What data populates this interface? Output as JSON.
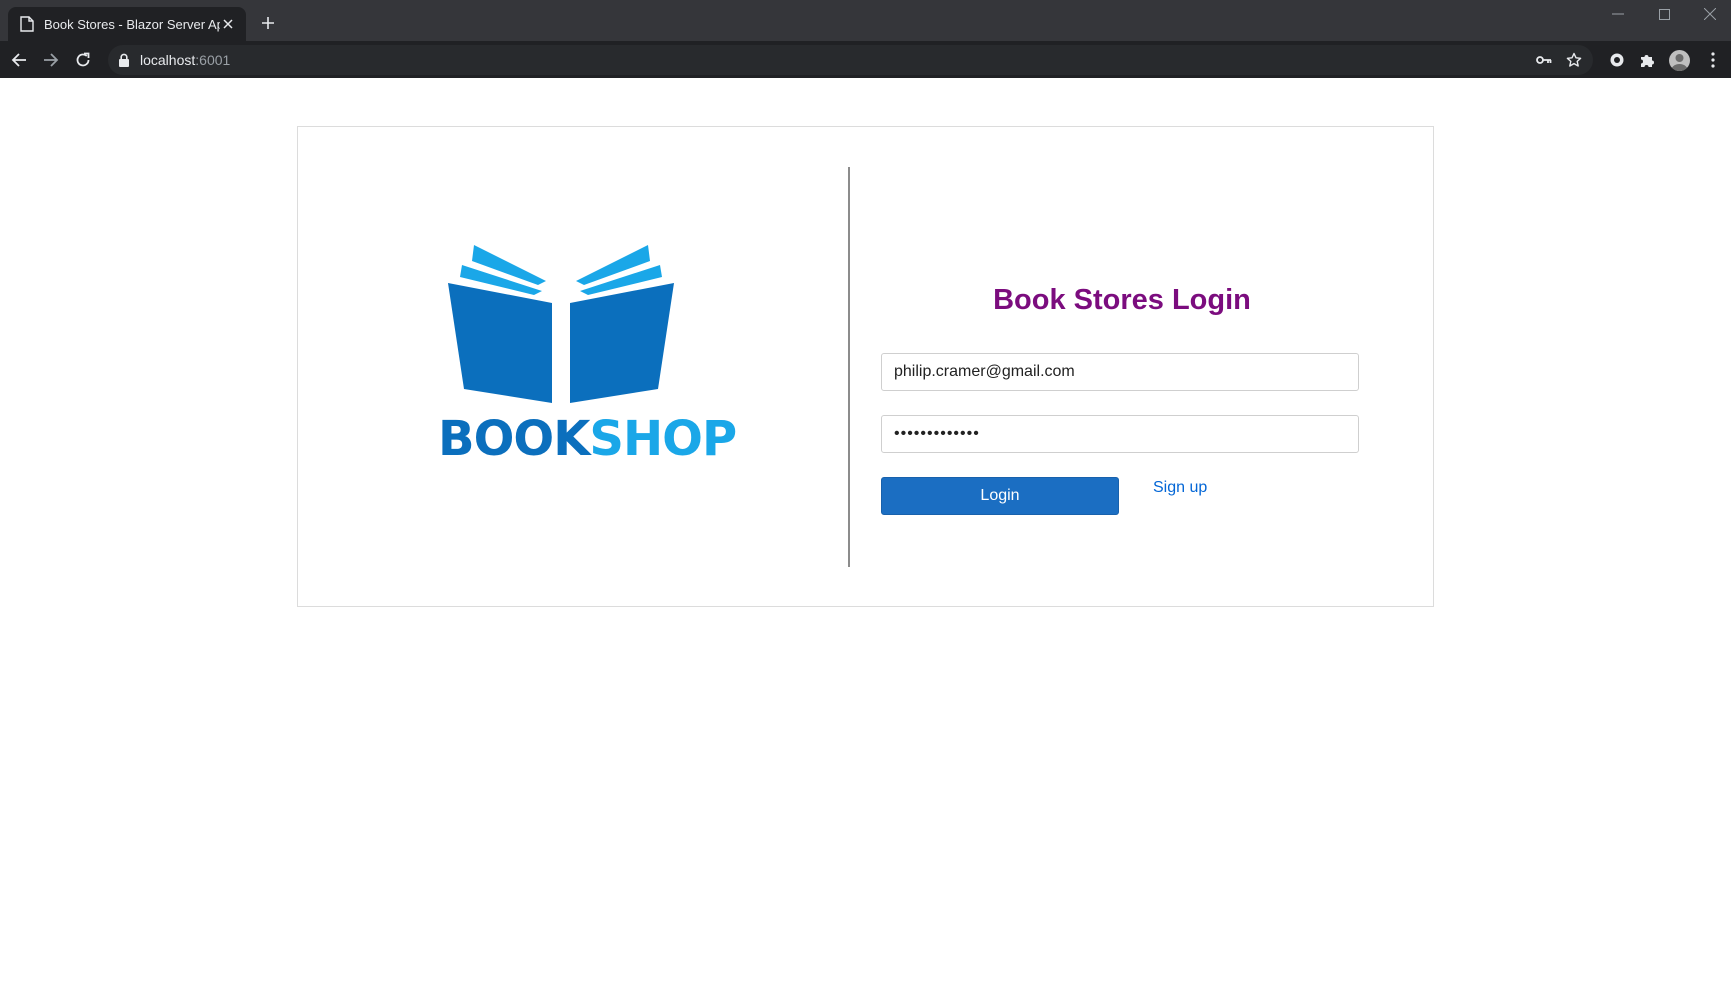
{
  "browser": {
    "tab_title": "Book Stores - Blazor Server App",
    "url_host": "localhost",
    "url_port": ":6001"
  },
  "logo": {
    "brand_part1": "BOOK",
    "brand_part2": "SHOP",
    "colors": {
      "dark_blue": "#0b6fbd",
      "light_blue": "#1aa7e8"
    }
  },
  "login": {
    "title": "Book Stores Login",
    "email_value": "philip.cramer@gmail.com",
    "password_value": "•••••••••••••",
    "login_button": "Login",
    "signup_link": "Sign up",
    "title_color": "#7b0c7e",
    "button_color": "#1b6ec2"
  }
}
